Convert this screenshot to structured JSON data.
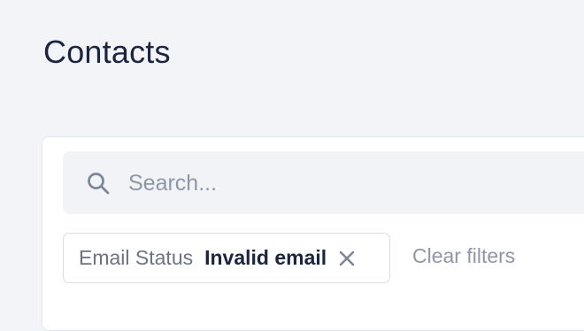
{
  "page": {
    "title": "Contacts"
  },
  "search": {
    "placeholder": "Search...",
    "value": "",
    "icon": "search-icon"
  },
  "filters": {
    "active": [
      {
        "field": "Email Status",
        "value": "Invalid email",
        "remove_icon": "close-icon"
      }
    ],
    "clear_label": "Clear filters"
  },
  "colors": {
    "background": "#f3f4f7",
    "card": "#ffffff",
    "title": "#1b2540",
    "muted_text": "#8e97a7",
    "search_background": "#f1f3f6"
  }
}
